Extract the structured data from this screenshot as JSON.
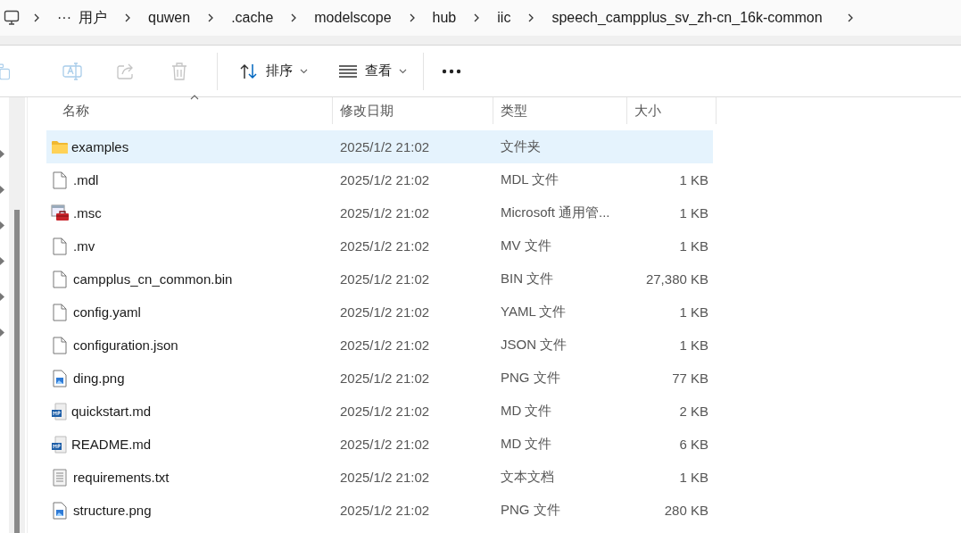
{
  "breadcrumb": {
    "overflow": "···",
    "items": [
      "用户",
      "quwen",
      ".cache",
      "modelscope",
      "hub",
      "iic",
      "speech_campplus_sv_zh-cn_16k-common"
    ]
  },
  "toolbar": {
    "actions": [
      {
        "kind": "copy",
        "disabled": true
      },
      {
        "kind": "rename",
        "disabled": true
      },
      {
        "kind": "share",
        "disabled": true
      },
      {
        "kind": "delete",
        "disabled": true
      }
    ],
    "sort": {
      "label": "排序"
    },
    "view": {
      "label": "查看"
    }
  },
  "table": {
    "columns": [
      {
        "label": "名称",
        "sorted": true
      },
      {
        "label": "修改日期",
        "sorted": false
      },
      {
        "label": "类型",
        "sorted": false
      },
      {
        "label": "大小",
        "sorted": false
      }
    ],
    "rows": [
      {
        "kind": "folder",
        "name": "examples",
        "date": "2025/1/2 21:02",
        "type": "文件夹",
        "selected": true
      },
      {
        "kind": "file",
        "name": ".mdl",
        "date": "2025/1/2 21:02",
        "type": "MDL 文件",
        "size": "1 KB",
        "selected": false
      },
      {
        "kind": "app",
        "name": ".msc",
        "date": "2025/1/2 21:02",
        "type": "Microsoft 通用管...",
        "size": "1 KB",
        "selected": false
      },
      {
        "kind": "file",
        "name": ".mv",
        "date": "2025/1/2 21:02",
        "type": "MV 文件",
        "size": "1 KB",
        "selected": false
      },
      {
        "kind": "file",
        "name": "campplus_cn_common.bin",
        "date": "2025/1/2 21:02",
        "type": "BIN 文件",
        "size": "27,380 KB",
        "selected": false
      },
      {
        "kind": "file",
        "name": "config.yaml",
        "date": "2025/1/2 21:02",
        "type": "YAML 文件",
        "size": "1 KB",
        "selected": false
      },
      {
        "kind": "file",
        "name": "configuration.json",
        "date": "2025/1/2 21:02",
        "type": "JSON 文件",
        "size": "1 KB",
        "selected": false
      },
      {
        "kind": "image",
        "name": "ding.png",
        "date": "2025/1/2 21:02",
        "type": "PNG 文件",
        "size": "77 KB",
        "selected": false
      },
      {
        "kind": "markdown",
        "name": "quickstart.md",
        "date": "2025/1/2 21:02",
        "type": "MD 文件",
        "size": "2 KB",
        "selected": false
      },
      {
        "kind": "markdown",
        "name": "README.md",
        "date": "2025/1/2 21:02",
        "type": "MD 文件",
        "size": "6 KB",
        "selected": false
      },
      {
        "kind": "text",
        "name": "requirements.txt",
        "date": "2025/1/2 21:02",
        "type": "文本文档",
        "size": "1 KB",
        "selected": false
      },
      {
        "kind": "image",
        "name": "structure.png",
        "date": "2025/1/2 21:02",
        "type": "PNG 文件",
        "size": "280 KB",
        "selected": false
      }
    ]
  }
}
